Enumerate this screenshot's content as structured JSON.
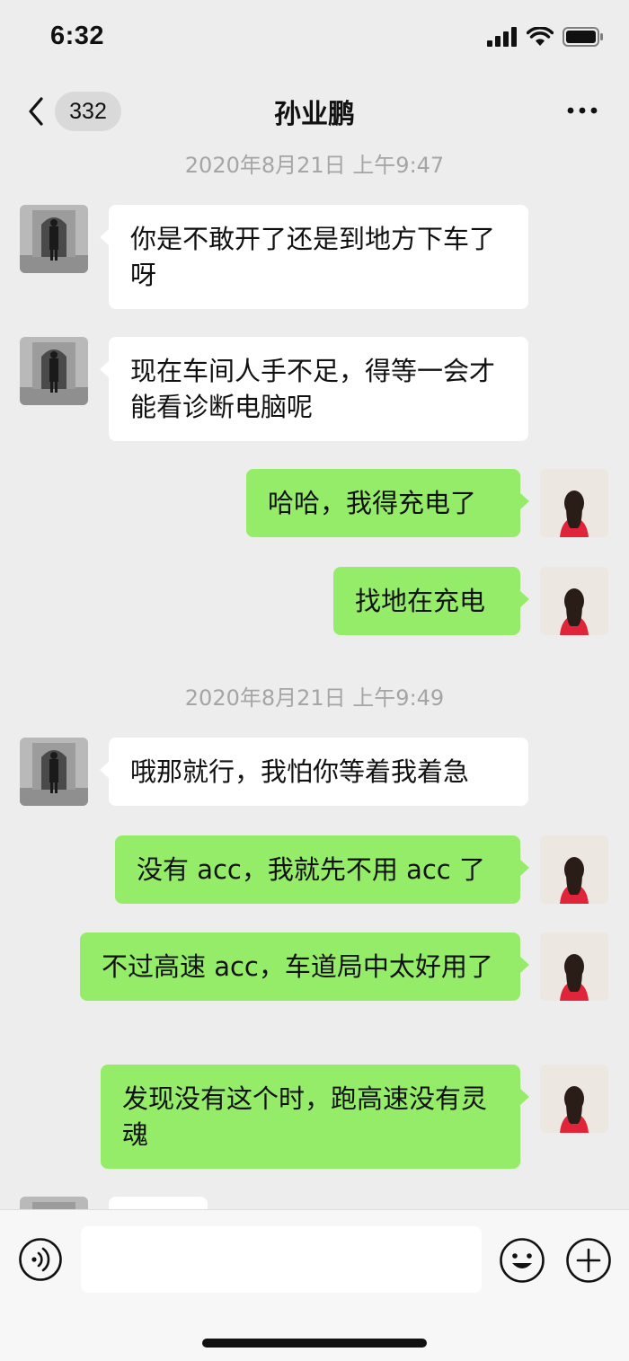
{
  "status_bar": {
    "time": "6:32"
  },
  "nav": {
    "unread_count": "332",
    "title": "孙业鹏"
  },
  "timestamps": [
    "2020年8月21日 上午9:47",
    "2020年8月21日 上午9:49"
  ],
  "messages": [
    {
      "side": "left",
      "text": "你是不敢开了还是到地方下车了呀"
    },
    {
      "side": "left",
      "text": "现在车间人手不足，得等一会才能看诊断电脑呢"
    },
    {
      "side": "right",
      "text": "哈哈，我得充电了"
    },
    {
      "side": "right",
      "text": "找地在充电"
    },
    {
      "side": "left",
      "text": "哦那就行，我怕你等着我着急"
    },
    {
      "side": "right",
      "text": "没有 acc，我就先不用 acc 了"
    },
    {
      "side": "right",
      "text": "不过高速 acc，车道局中太好用了"
    },
    {
      "side": "right",
      "text": "发现没有这个时，跑高速没有灵魂"
    }
  ],
  "input": {
    "value": "",
    "placeholder": ""
  },
  "icons": {
    "back": "chevron-left-icon",
    "more": "more-dots-icon",
    "voice": "voice-icon",
    "emoji": "emoji-icon",
    "plus": "plus-icon"
  },
  "colors": {
    "background": "#ededed",
    "bubble_self": "#95ec69",
    "bubble_other": "#ffffff",
    "timestamp": "#a5a5a5"
  }
}
